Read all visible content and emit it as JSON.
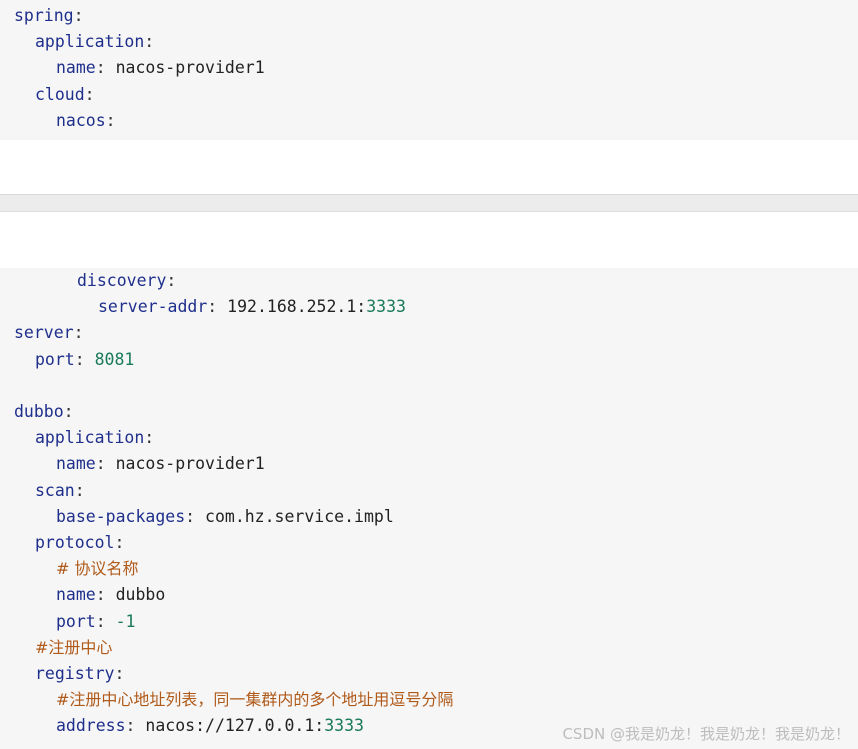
{
  "block1": {
    "lines": [
      {
        "indent": 0,
        "key": "spring",
        "colon": ":"
      },
      {
        "indent": 1,
        "key": "application",
        "colon": ":"
      },
      {
        "indent": 2,
        "key": "name",
        "colon": ": ",
        "value": "nacos-provider1"
      },
      {
        "indent": 1,
        "key": "cloud",
        "colon": ":"
      },
      {
        "indent": 2,
        "key": "nacos",
        "colon": ":"
      }
    ]
  },
  "block2": {
    "lines": [
      {
        "indent": 3,
        "key": "discovery",
        "colon": ":"
      },
      {
        "indent": 4,
        "key": "server-addr",
        "colon": ": ",
        "value": "192.168.252.1:",
        "number": "3333"
      },
      {
        "indent": 0,
        "key": "server",
        "colon": ":"
      },
      {
        "indent": 1,
        "key": "port",
        "colon": ": ",
        "number": "8081"
      },
      {
        "indent": 0,
        "key": "",
        "colon": ""
      },
      {
        "indent": 0,
        "key": "dubbo",
        "colon": ":"
      },
      {
        "indent": 1,
        "key": "application",
        "colon": ":"
      },
      {
        "indent": 2,
        "key": "name",
        "colon": ": ",
        "value": "nacos-provider1"
      },
      {
        "indent": 1,
        "key": "scan",
        "colon": ":"
      },
      {
        "indent": 2,
        "key": "base-packages",
        "colon": ": ",
        "value": "com.hz.service.impl"
      },
      {
        "indent": 1,
        "key": "protocol",
        "colon": ":"
      },
      {
        "indent": 2,
        "comment": "# 协议名称"
      },
      {
        "indent": 2,
        "key": "name",
        "colon": ": ",
        "value": "dubbo"
      },
      {
        "indent": 2,
        "key": "port",
        "colon": ": ",
        "number": "-1"
      },
      {
        "indent": 1,
        "comment": "#注册中心"
      },
      {
        "indent": 1,
        "key": "registry",
        "colon": ":"
      },
      {
        "indent": 2,
        "comment": "#注册中心地址列表，同一集群内的多个地址用逗号分隔"
      },
      {
        "indent": 2,
        "key": "address",
        "colon": ": ",
        "value": "nacos://127.0.0.1:",
        "number": "3333"
      }
    ]
  },
  "watermark": "CSDN @我是奶龙！我是奶龙！我是奶龙！"
}
